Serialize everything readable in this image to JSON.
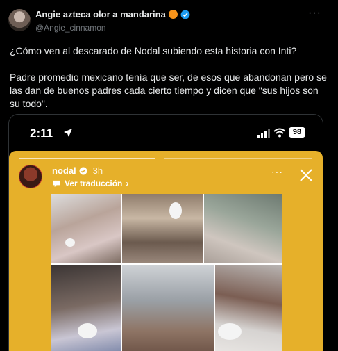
{
  "tweet": {
    "author_name": "Angie azteca olor a mandarina",
    "handle": "@Angie_cinnamon",
    "more_label": "···",
    "paragraph1": "¿Cómo ven al descarado de Nodal subiendo esta historia con Inti?",
    "paragraph2": "Padre promedio mexicano tenía que ser, de esos que abandonan pero se las dan de buenos padres cada cierto tiempo y dicen que \"sus hijos son su todo\"."
  },
  "phone": {
    "time": "2:11",
    "battery": "98"
  },
  "story": {
    "username": "nodal",
    "time_ago": "3h",
    "translate_label": "Ver traducción",
    "more_label": "···"
  },
  "colors": {
    "background": "#000000",
    "story_background": "#e6b02a",
    "verified_blue": "#1d9bf0",
    "badge_orange": "#f7931a"
  }
}
